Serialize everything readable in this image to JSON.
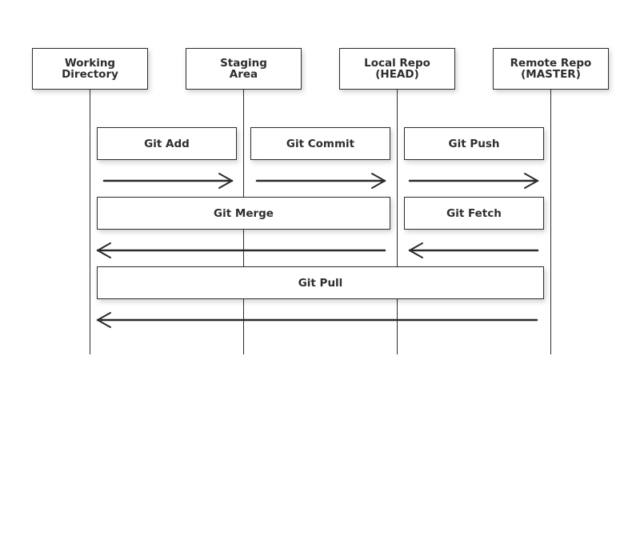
{
  "actors": [
    {
      "label": "Working\nDirectory"
    },
    {
      "label": "Staging\nArea"
    },
    {
      "label": "Local Repo\n(HEAD)"
    },
    {
      "label": "Remote Repo\n(MASTER)"
    }
  ],
  "messages": [
    {
      "label": "Git Add",
      "from": 0,
      "to": 1,
      "direction": "right"
    },
    {
      "label": "Git Commit",
      "from": 1,
      "to": 2,
      "direction": "right"
    },
    {
      "label": "Git Push",
      "from": 2,
      "to": 3,
      "direction": "right"
    },
    {
      "label": "Git Merge",
      "from": 2,
      "to": 0,
      "direction": "left"
    },
    {
      "label": "Git Fetch",
      "from": 3,
      "to": 2,
      "direction": "left"
    },
    {
      "label": "Git Pull",
      "from": 3,
      "to": 0,
      "direction": "left"
    }
  ],
  "colors": {
    "stroke": "#2b2b2b",
    "text": "#2e2e2e",
    "background": "#ffffff"
  }
}
